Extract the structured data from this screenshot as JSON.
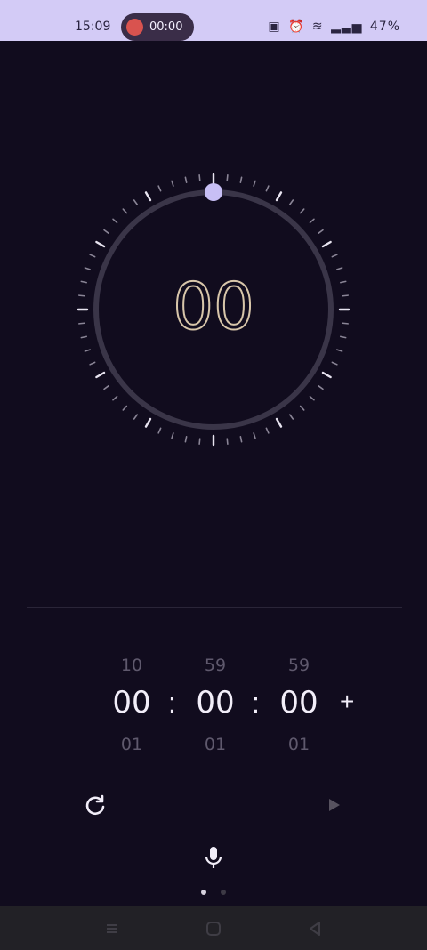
{
  "status_bar": {
    "time": "15:09",
    "recording_time": "00:00",
    "battery": "47%",
    "icons": [
      "nfc-icon",
      "alarm-icon",
      "wifi-icon",
      "signal-icon"
    ]
  },
  "timer_display": {
    "minutes_digits": "00",
    "progress_fraction": 0.0
  },
  "picker": {
    "hours": {
      "prev": "10",
      "current": "00",
      "next": "01"
    },
    "minutes": {
      "prev": "59",
      "current": "00",
      "next": "01"
    },
    "seconds": {
      "prev": "59",
      "current": "00",
      "next": "01"
    },
    "separator": ":",
    "add_label": "+"
  },
  "controls": {
    "reset_icon": "reset-icon",
    "start_icon": "play-icon",
    "voice_icon": "microphone-icon"
  },
  "pager": {
    "pages": 2,
    "active_index": 0
  },
  "colors": {
    "background": "#110c1e",
    "accent": "#c8bff5",
    "status_bar": "#d3cbf6",
    "digit_outline": "#d8c6aa"
  }
}
